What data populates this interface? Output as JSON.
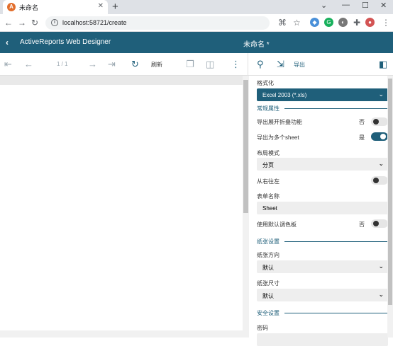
{
  "browser": {
    "tab_title": "未命名",
    "tab_favicon_letter": "A",
    "url": "localhost:58721/create",
    "new_tab_glyph": "+",
    "close_glyph": "✕",
    "nav": {
      "back": "←",
      "forward": "→",
      "reload": "↻"
    }
  },
  "app": {
    "title": "ActiveReports Web Designer",
    "document_title": "未命名 *",
    "accent": "#1f5f7a"
  },
  "toolbar": {
    "page_indicator": "1 / 1",
    "refresh_label": "刷新",
    "export_label": "导出"
  },
  "export_panel": {
    "format_label": "格式化",
    "format_value": "Excel 2003 (*.xls)",
    "general_section": "常规属性",
    "collapse_label": "导出展开折叠功能",
    "collapse_state": "否",
    "multi_sheet_label": "导出为多个sheet",
    "multi_sheet_state": "是",
    "layout_label": "布局模式",
    "layout_value": "分页",
    "rtl_label": "从右往左",
    "sheet_name_label": "表单名称",
    "sheet_name_value": "Sheet",
    "palette_label": "使用默认调色板",
    "palette_state": "否",
    "paper_section": "纸张设置",
    "orientation_label": "纸张方向",
    "orientation_value": "默认",
    "paper_size_label": "纸张尺寸",
    "paper_size_value": "默认",
    "security_section": "安全设置",
    "password_label": "密码"
  }
}
